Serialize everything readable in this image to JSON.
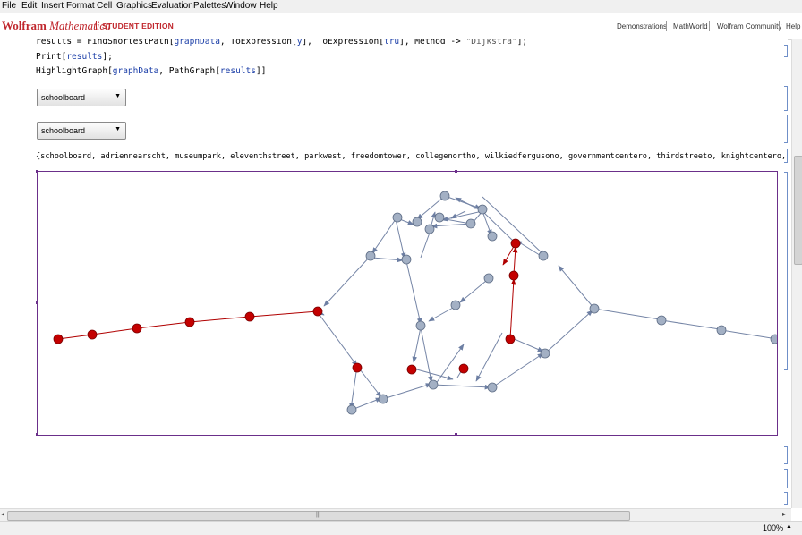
{
  "menu": [
    "File",
    "Edit",
    "Insert",
    "Format",
    "Cell",
    "Graphics",
    "Evaluation",
    "Palettes",
    "Window",
    "Help"
  ],
  "brand": {
    "word1": "Wolfram",
    "word2": "Mathematica",
    "edition": "STUDENT EDITION"
  },
  "toplinks": [
    "Demonstrations",
    "MathWorld",
    "Wolfram Community",
    "Help"
  ],
  "code": {
    "line1": {
      "a": "results = FindShortestPath[",
      "b": "graphData",
      "c": ", ToExpression[",
      "d": "y",
      "e": "], ToExpression[",
      "f": "tru",
      "g": "], Method -> ",
      "h": "\"Dijkstra\"",
      "i": "];"
    },
    "line2": {
      "a": "Print[",
      "b": "results",
      "c": "];"
    },
    "line3": {
      "a": "HighlightGraph[",
      "b": "graphData",
      "c": ", PathGraph[",
      "d": "results",
      "e": "]]"
    }
  },
  "popups": {
    "start": "schoolboard",
    "end": "schoolboard"
  },
  "output": "{schoolboard, adriennearscht, museumpark, eleventhstreet, parkwest, freedomtower, collegenortho, wilkiedfergusono, governmentcentero, thirdstreeto, knightcentero, knightcenteri}",
  "statusbar": {
    "zoom": "100%"
  },
  "colors": {
    "path": "#c40000",
    "vertex": "#a3b0c4",
    "edge": "#7585a6",
    "frame": "#6b2f8a",
    "brand": "#c0272d"
  }
}
